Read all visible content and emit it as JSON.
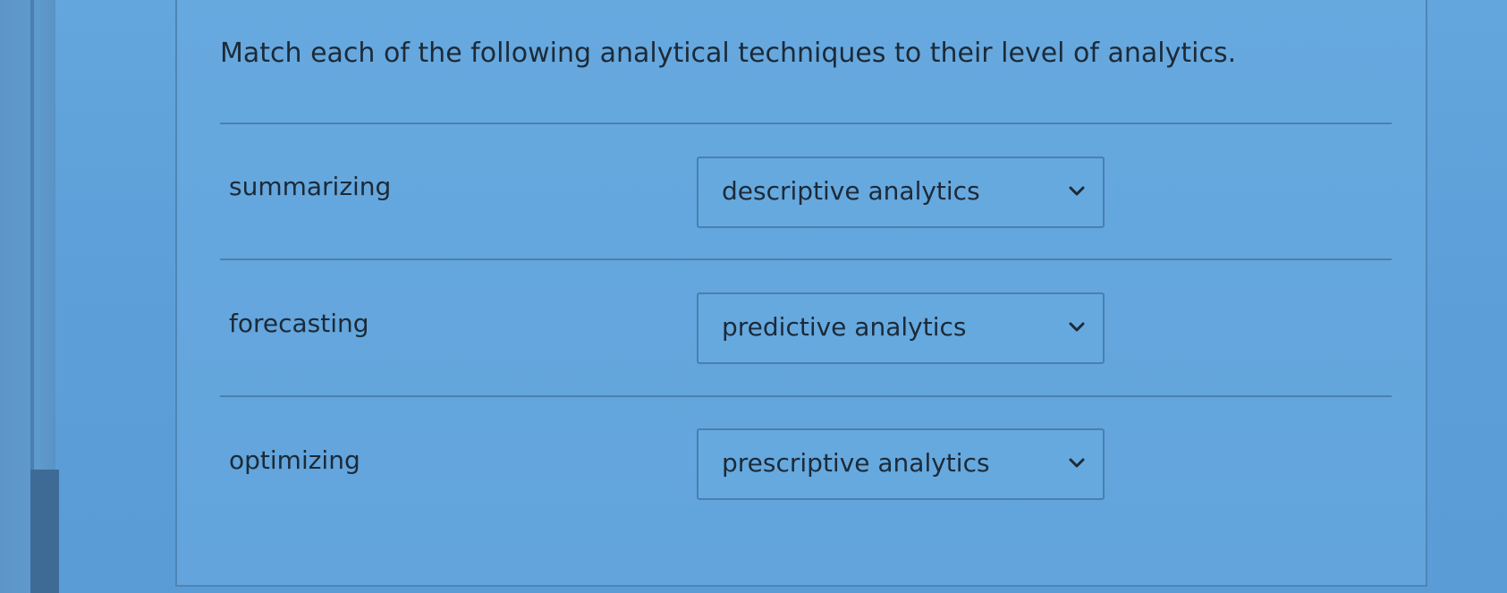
{
  "question": {
    "prompt": "Match each of the following analytical techniques to their level of analytics."
  },
  "matches": [
    {
      "term": "summarizing",
      "selected": "descriptive analytics",
      "icon": "chevron-down-icon"
    },
    {
      "term": "forecasting",
      "selected": "predictive analytics",
      "icon": "chevron-down-icon"
    },
    {
      "term": "optimizing",
      "selected": "prescriptive analytics",
      "icon": "chevron-down-icon"
    }
  ],
  "colors": {
    "background": "#5f9fd6",
    "text": "#1c2a38",
    "border": "#4a7fb0"
  }
}
